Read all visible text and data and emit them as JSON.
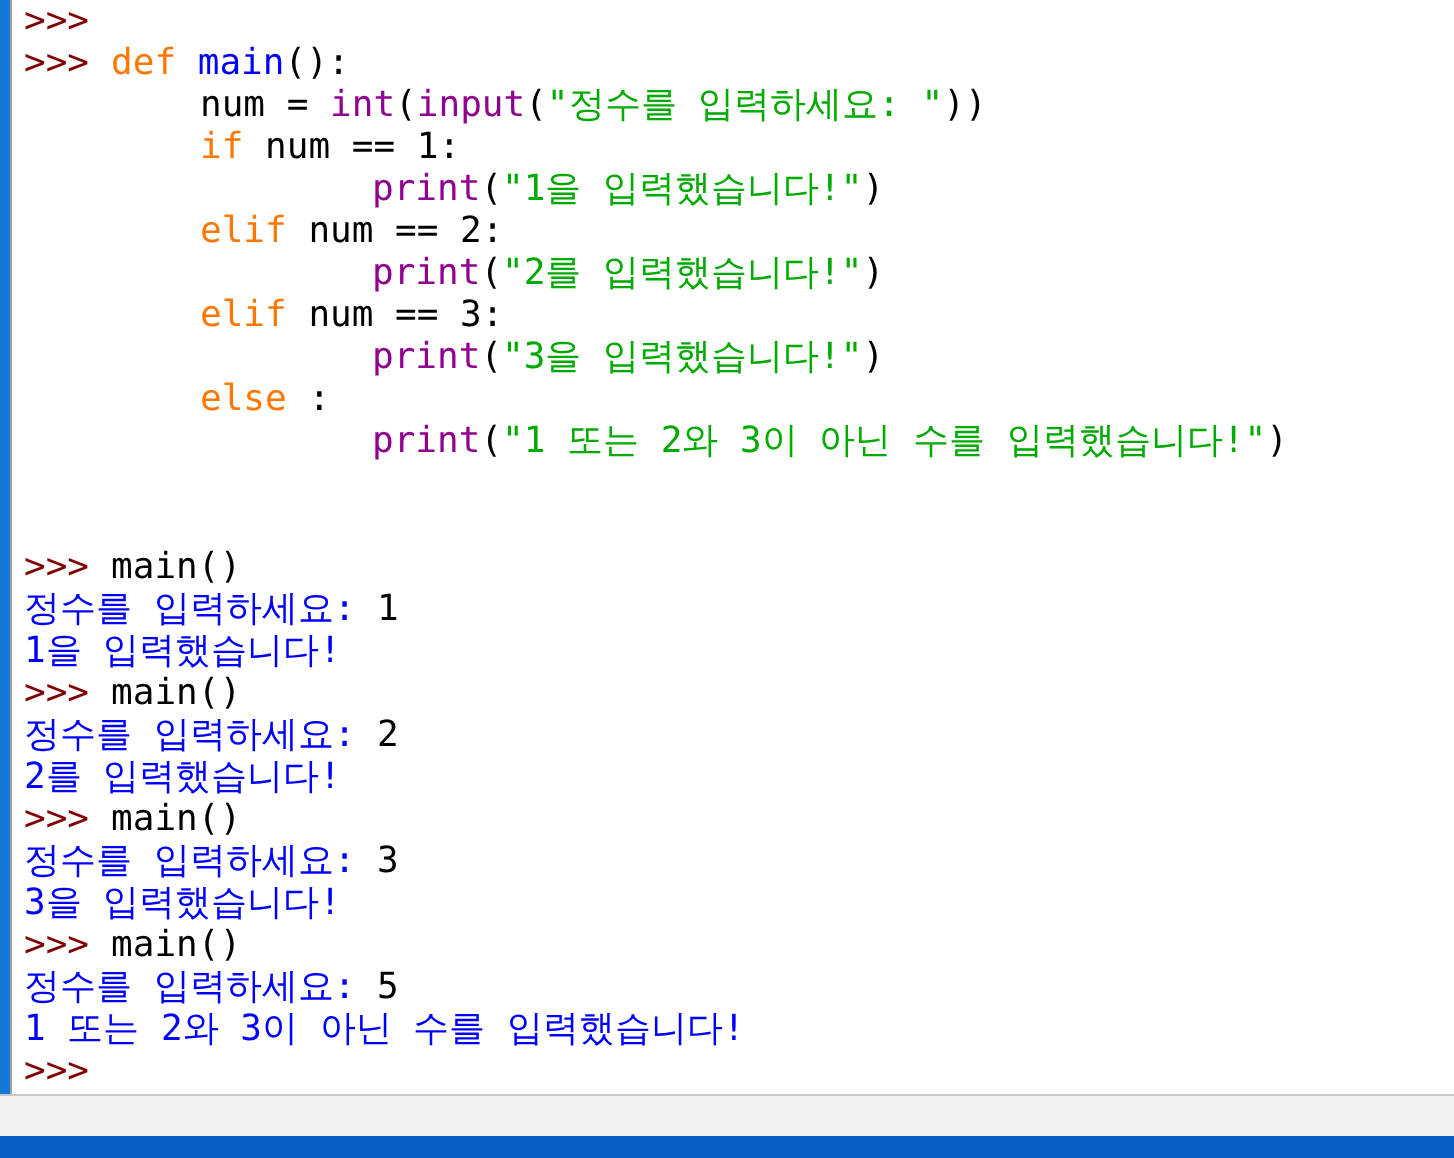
{
  "shell": [
    {
      "prompt": ">>>"
    },
    {
      "prompt": ">>>",
      "segments": [
        {
          "kind": "keyword",
          "text": "def "
        },
        {
          "kind": "defname",
          "text": "main"
        },
        {
          "kind": "plain",
          "text": "():"
        }
      ],
      "children": [
        {
          "segments": [
            {
              "kind": "plain",
              "text": "num = "
            },
            {
              "kind": "builtin",
              "text": "int"
            },
            {
              "kind": "plain",
              "text": "("
            },
            {
              "kind": "builtin",
              "text": "input"
            },
            {
              "kind": "plain",
              "text": "("
            },
            {
              "kind": "string",
              "text": "\"정수를 입력하세요: \""
            },
            {
              "kind": "plain",
              "text": "))"
            }
          ]
        },
        {
          "segments": [
            {
              "kind": "keyword",
              "text": "if"
            },
            {
              "kind": "plain",
              "text": " num == 1:"
            }
          ],
          "children": [
            {
              "segments": [
                {
                  "kind": "builtin",
                  "text": "print"
                },
                {
                  "kind": "plain",
                  "text": "("
                },
                {
                  "kind": "string",
                  "text": "\"1을 입력했습니다!\""
                },
                {
                  "kind": "plain",
                  "text": ")"
                }
              ]
            }
          ]
        },
        {
          "segments": [
            {
              "kind": "keyword",
              "text": "elif"
            },
            {
              "kind": "plain",
              "text": " num == 2:"
            }
          ],
          "children": [
            {
              "segments": [
                {
                  "kind": "builtin",
                  "text": "print"
                },
                {
                  "kind": "plain",
                  "text": "("
                },
                {
                  "kind": "string",
                  "text": "\"2를 입력했습니다!\""
                },
                {
                  "kind": "plain",
                  "text": ")"
                }
              ]
            }
          ]
        },
        {
          "segments": [
            {
              "kind": "keyword",
              "text": "elif"
            },
            {
              "kind": "plain",
              "text": " num == 3:"
            }
          ],
          "children": [
            {
              "segments": [
                {
                  "kind": "builtin",
                  "text": "print"
                },
                {
                  "kind": "plain",
                  "text": "("
                },
                {
                  "kind": "string",
                  "text": "\"3을 입력했습니다!\""
                },
                {
                  "kind": "plain",
                  "text": ")"
                }
              ]
            }
          ]
        },
        {
          "segments": [
            {
              "kind": "keyword",
              "text": "else"
            },
            {
              "kind": "plain",
              "text": " :"
            }
          ],
          "children": [
            {
              "segments": [
                {
                  "kind": "builtin",
                  "text": "print"
                },
                {
                  "kind": "plain",
                  "text": "("
                },
                {
                  "kind": "string",
                  "text": "\"1 또는 2와 3이 아닌 수를 입력했습니다!\""
                },
                {
                  "kind": "plain",
                  "text": ")"
                }
              ]
            }
          ]
        }
      ]
    },
    {
      "prompt": ">>>",
      "segments": [
        {
          "kind": "plain",
          "text": "main()"
        }
      ]
    },
    {
      "segments": [
        {
          "kind": "stdout",
          "text": "정수를 입력하세요: "
        },
        {
          "kind": "plain",
          "text": "1"
        }
      ]
    },
    {
      "segments": [
        {
          "kind": "stdout",
          "text": "1을 입력했습니다!"
        }
      ]
    },
    {
      "prompt": ">>>",
      "segments": [
        {
          "kind": "plain",
          "text": "main()"
        }
      ]
    },
    {
      "segments": [
        {
          "kind": "stdout",
          "text": "정수를 입력하세요: "
        },
        {
          "kind": "plain",
          "text": "2"
        }
      ]
    },
    {
      "segments": [
        {
          "kind": "stdout",
          "text": "2를 입력했습니다!"
        }
      ]
    },
    {
      "prompt": ">>>",
      "segments": [
        {
          "kind": "plain",
          "text": "main()"
        }
      ]
    },
    {
      "segments": [
        {
          "kind": "stdout",
          "text": "정수를 입력하세요: "
        },
        {
          "kind": "plain",
          "text": "3"
        }
      ]
    },
    {
      "segments": [
        {
          "kind": "stdout",
          "text": "3을 입력했습니다!"
        }
      ]
    },
    {
      "prompt": ">>>",
      "segments": [
        {
          "kind": "plain",
          "text": "main()"
        }
      ]
    },
    {
      "segments": [
        {
          "kind": "stdout",
          "text": "정수를 입력하세요: "
        },
        {
          "kind": "plain",
          "text": "5"
        }
      ]
    },
    {
      "segments": [
        {
          "kind": "stdout",
          "text": "1 또는 2와 3이 아닌 수를 입력했습니다!"
        }
      ]
    },
    {
      "prompt": ">>>"
    }
  ]
}
